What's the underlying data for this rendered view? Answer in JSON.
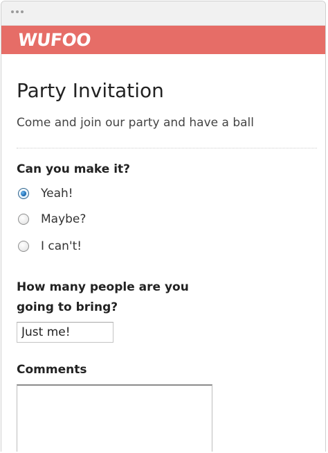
{
  "brand": {
    "logo_text": "WUFOO",
    "bar_color": "#e66d67"
  },
  "form": {
    "title": "Party Invitation",
    "subtitle": "Come and join our party and have a ball",
    "attendance": {
      "label": "Can you make it?",
      "options": [
        {
          "label": "Yeah!",
          "checked": true
        },
        {
          "label": "Maybe?",
          "checked": false
        },
        {
          "label": "I can't!",
          "checked": false
        }
      ]
    },
    "guests": {
      "label": "How many people are you going to bring?",
      "value": "Just me!"
    },
    "comments": {
      "label": "Comments",
      "value": ""
    }
  },
  "icons": {
    "window_dots": "ellipsis-icon",
    "radio_selected_color": "#1f6fb5"
  }
}
